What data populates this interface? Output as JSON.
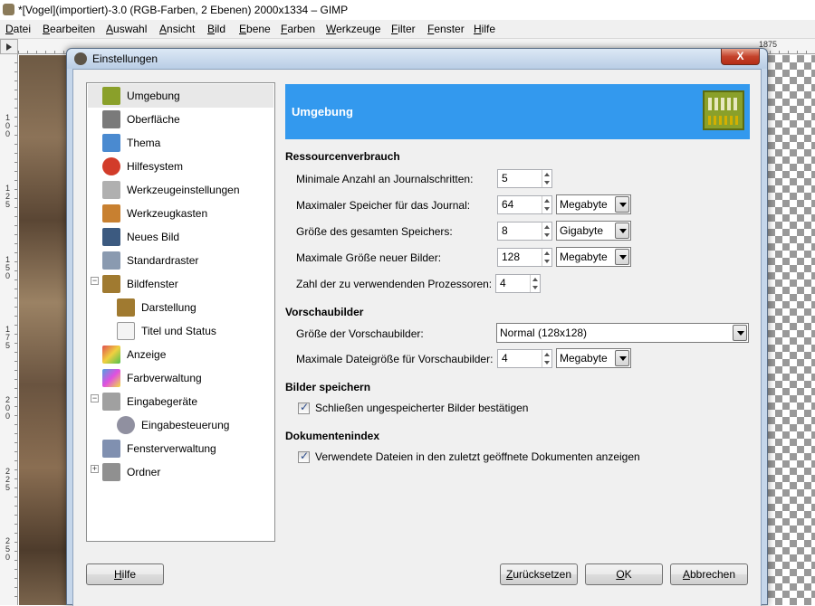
{
  "main_window": {
    "title": "*[Vogel](importiert)-3.0 (RGB-Farben, 2 Ebenen) 2000x1334 – GIMP",
    "menu": [
      "Datei",
      "Bearbeiten",
      "Auswahl",
      "Ansicht",
      "Bild",
      "Ebene",
      "Farben",
      "Werkzeuge",
      "Filter",
      "Fenster",
      "Hilfe"
    ],
    "ruler_mark": "1875",
    "left_ruler_digits": [
      "1\n0\n0",
      "1\n2\n5",
      "1\n5\n0",
      "1\n7\n5",
      "2\n0\n0",
      "2\n2\n5",
      "2\n5\n0"
    ]
  },
  "dialog": {
    "title": "Einstellungen",
    "close_label": "X",
    "tree": [
      {
        "label": "Umgebung",
        "icon": "chip-icon",
        "color": "#8aa02a",
        "selected": true
      },
      {
        "label": "Oberfläche",
        "icon": "interface-icon",
        "color": "#7a7a7a"
      },
      {
        "label": "Thema",
        "icon": "theme-icon",
        "color": "#4a8ad0"
      },
      {
        "label": "Hilfesystem",
        "icon": "lifebuoy-icon",
        "color": "#d23c2a"
      },
      {
        "label": "Werkzeugeinstellungen",
        "icon": "tool-options-icon",
        "color": "#b0b0b0"
      },
      {
        "label": "Werkzeugkasten",
        "icon": "toolbox-icon",
        "color": "#c88030"
      },
      {
        "label": "Neues Bild",
        "icon": "new-image-icon",
        "color": "#3c5a80"
      },
      {
        "label": "Standardraster",
        "icon": "grid-icon",
        "color": "#8a9ab0"
      },
      {
        "label": "Bildfenster",
        "icon": "image-window-icon",
        "color": "#a07a30"
      },
      {
        "label": "Darstellung",
        "icon": "appearance-icon",
        "color": "#a07a30"
      },
      {
        "label": "Titel und Status",
        "icon": "title-status-icon",
        "color": "#c04040"
      },
      {
        "label": "Anzeige",
        "icon": "display-icon",
        "color": "#e05050"
      },
      {
        "label": "Farbverwaltung",
        "icon": "color-management-icon",
        "color": "#50a0e0"
      },
      {
        "label": "Eingabegeräte",
        "icon": "input-devices-icon",
        "color": "#a0a0a0"
      },
      {
        "label": "Eingabesteuerung",
        "icon": "input-controllers-icon",
        "color": "#9090a0"
      },
      {
        "label": "Fensterverwaltung",
        "icon": "window-management-icon",
        "color": "#8090b0"
      },
      {
        "label": "Ordner",
        "icon": "folders-icon",
        "color": "#909090"
      }
    ],
    "panel": {
      "banner_title": "Umgebung",
      "banner_color": "#3399ee",
      "sections": {
        "resources": "Ressourcenverbrauch",
        "thumbnails": "Vorschaubilder",
        "saving": "Bilder speichern",
        "docindex": "Dokumentenindex"
      },
      "resources": {
        "undo_levels_label": "Minimale Anzahl an Journalschritten:",
        "undo_levels_value": "5",
        "undo_memory_label": "Maximaler Speicher für das Journal:",
        "undo_memory_value": "64",
        "undo_memory_unit": "Megabyte",
        "tile_cache_label": "Größe des gesamten Speichers:",
        "tile_cache_value": "8",
        "tile_cache_unit": "Gigabyte",
        "new_image_label": "Maximale Größe neuer Bilder:",
        "new_image_value": "128",
        "new_image_unit": "Megabyte",
        "processors_label": "Zahl der zu verwendenden Prozessoren:",
        "processors_value": "4"
      },
      "thumbnails": {
        "size_label": "Größe der Vorschaubilder:",
        "size_value": "Normal (128x128)",
        "filesize_label": "Maximale Dateigröße für Vorschaubilder:",
        "filesize_value": "4",
        "filesize_unit": "Megabyte"
      },
      "saving": {
        "confirm_label": "Schließen ungespeicherter Bilder bestätigen",
        "confirm_checked": true
      },
      "docindex": {
        "recent_label": "Verwendete Dateien in den zuletzt geöffnete Dokumenten anzeigen",
        "recent_checked": true
      }
    },
    "buttons": {
      "help": "Hilfe",
      "reset": "Zurücksetzen",
      "ok": "OK",
      "cancel": "Abbrechen"
    }
  }
}
